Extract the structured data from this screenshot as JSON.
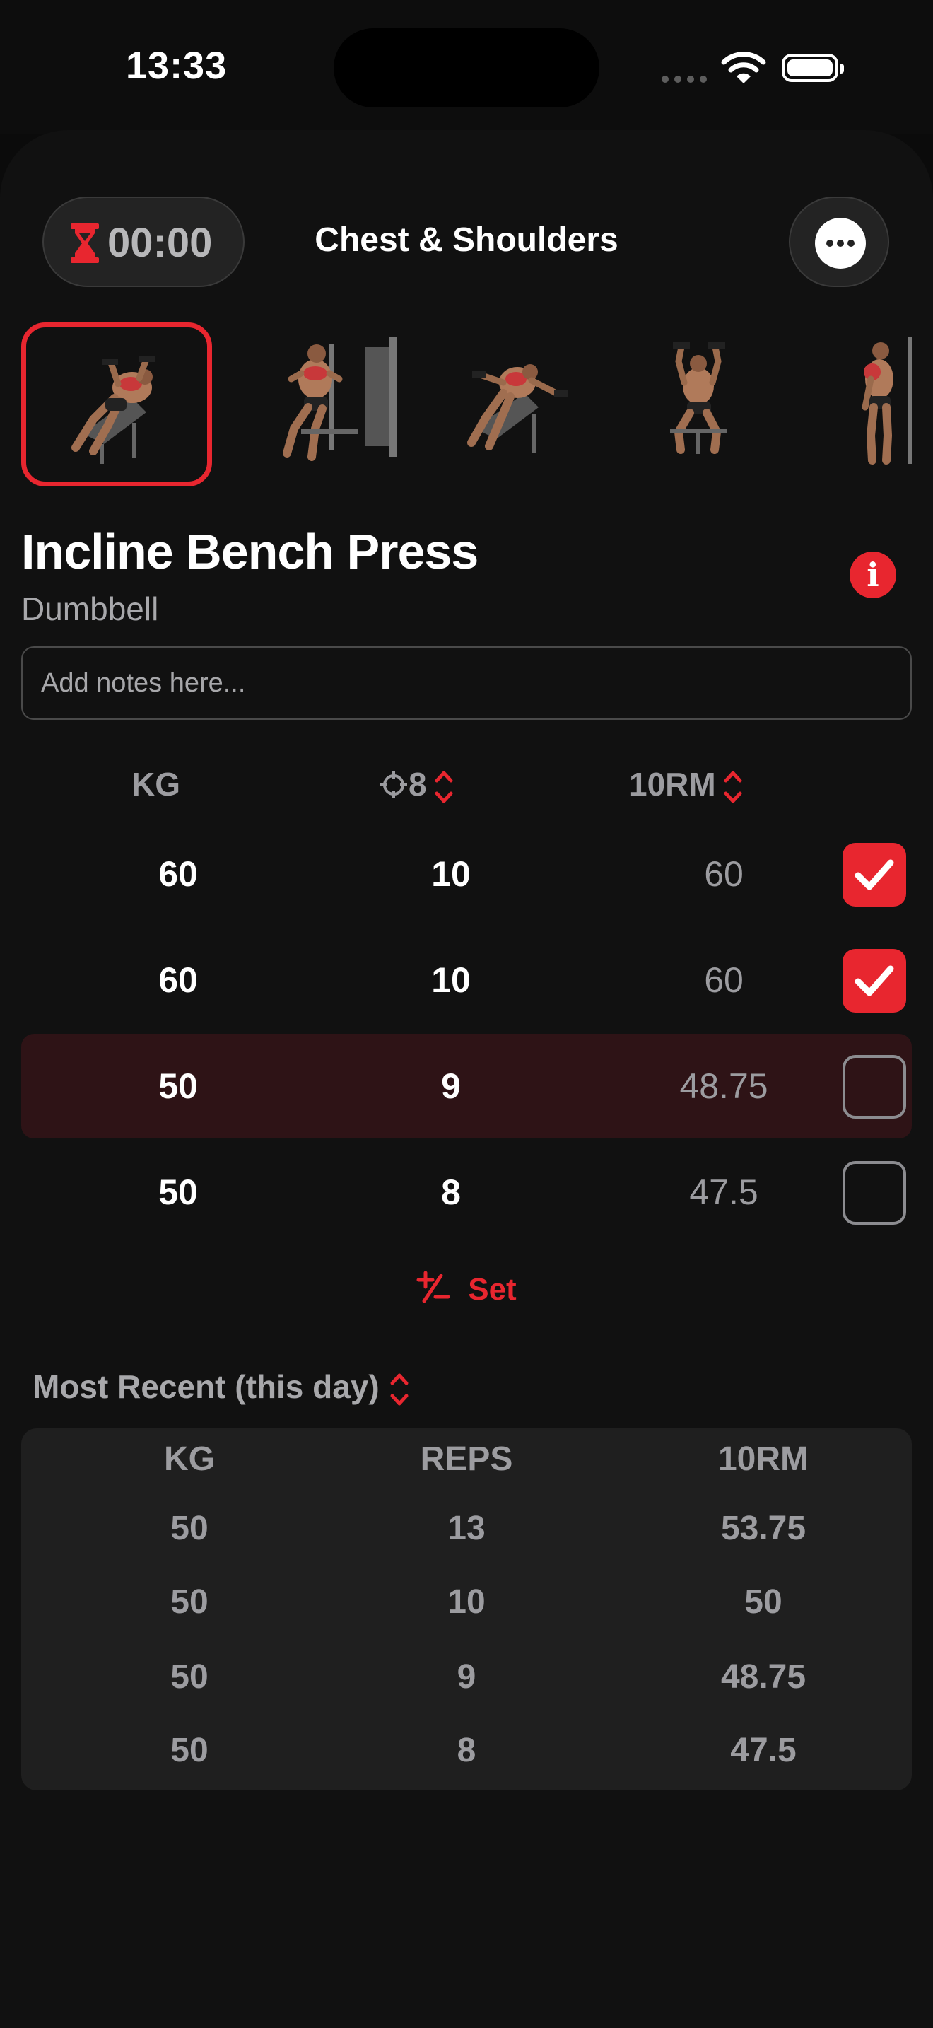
{
  "status_bar": {
    "time": "13:33"
  },
  "header": {
    "timer": "00:00",
    "title": "Chest & Shoulders"
  },
  "exercise": {
    "name": "Incline Bench Press",
    "equipment": "Dumbbell",
    "notes_placeholder": "Add notes here..."
  },
  "sets_table": {
    "headers": {
      "weight": "KG",
      "target": "8",
      "rm": "10RM"
    },
    "rows": [
      {
        "kg": "60",
        "reps": "10",
        "rm": "60",
        "done": true
      },
      {
        "kg": "60",
        "reps": "10",
        "rm": "60",
        "done": true
      },
      {
        "kg": "50",
        "reps": "9",
        "rm": "48.75",
        "done": false
      },
      {
        "kg": "50",
        "reps": "8",
        "rm": "47.5",
        "done": false
      }
    ],
    "add_set_label": "Set"
  },
  "history": {
    "title": "Most Recent (this day)",
    "headers": {
      "kg": "KG",
      "reps": "REPS",
      "rm": "10RM"
    },
    "rows": [
      {
        "kg": "50",
        "reps": "13",
        "rm": "53.75"
      },
      {
        "kg": "50",
        "reps": "10",
        "rm": "50"
      },
      {
        "kg": "50",
        "reps": "9",
        "rm": "48.75"
      },
      {
        "kg": "50",
        "reps": "8",
        "rm": "47.5"
      }
    ]
  },
  "colors": {
    "accent": "#e8262f",
    "active_row": "#2e1316",
    "background": "#111111"
  },
  "icons": [
    "hourglass-icon",
    "more-icon",
    "info-icon",
    "target-icon",
    "sort-icon",
    "checkmark-icon",
    "plus-minus-icon"
  ]
}
